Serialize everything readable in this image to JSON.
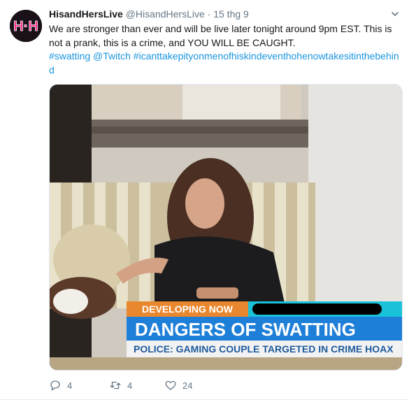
{
  "tweet": {
    "display_name": "HisandHersLive",
    "handle": "@HisandHersLive",
    "separator": "·",
    "timestamp": "15 thg 9",
    "text_line1": "We are stronger than ever and will be live later tonight around 9pm EST. This is",
    "text_line2": "not a prank, this is a crime, and YOU WILL BE CAUGHT.",
    "hashtags": "#swatting @Twitch #icanttakepityonmenofhiskindeventhohenowtakesitinthebehind",
    "avatar_logo": "H·H",
    "media": {
      "banner_tag": "DEVELOPING NOW",
      "headline": "DANGERS OF SWATTING",
      "subheadline": "POLICE: GAMING COUPLE TARGETED IN CRIME HOAX"
    },
    "actions": {
      "reply_count": "4",
      "retweet_count": "4",
      "like_count": "24"
    }
  },
  "colors": {
    "link": "#1b95e0",
    "muted": "#657786",
    "banner_blue": "#1e7fd8",
    "banner_orange": "#e8872e",
    "avatar_pink": "#ff2d8c"
  },
  "icons": [
    "caret-down-icon",
    "reply-icon",
    "retweet-icon",
    "like-icon"
  ]
}
